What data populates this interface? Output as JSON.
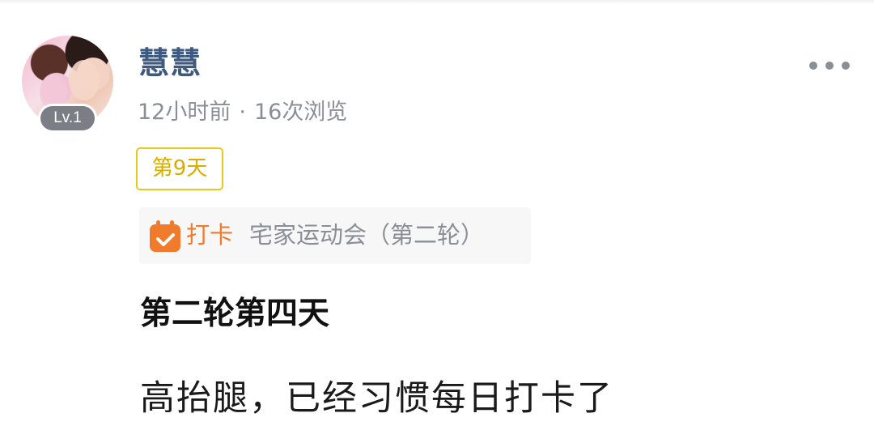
{
  "post": {
    "author": {
      "name": "慧慧",
      "level": "Lv.1"
    },
    "meta": {
      "time": "12小时前",
      "separator": "·",
      "views": "16次浏览"
    },
    "day_tag": "第9天",
    "checkin": {
      "label": "打卡",
      "topic": "宅家运动会（第二轮）",
      "icon": "calendar-check-icon"
    },
    "title": "第二轮第四天",
    "body": "高抬腿，已经习惯每日打卡了"
  },
  "icons": {
    "more": "more-dots-icon"
  },
  "colors": {
    "username": "#3f5a7f",
    "meta": "#8a8f96",
    "tag_border": "#e9c81c",
    "tag_text": "#d9ac00",
    "checkin_orange": "#f07b2c",
    "checkin_bg": "#f7f7f8"
  }
}
